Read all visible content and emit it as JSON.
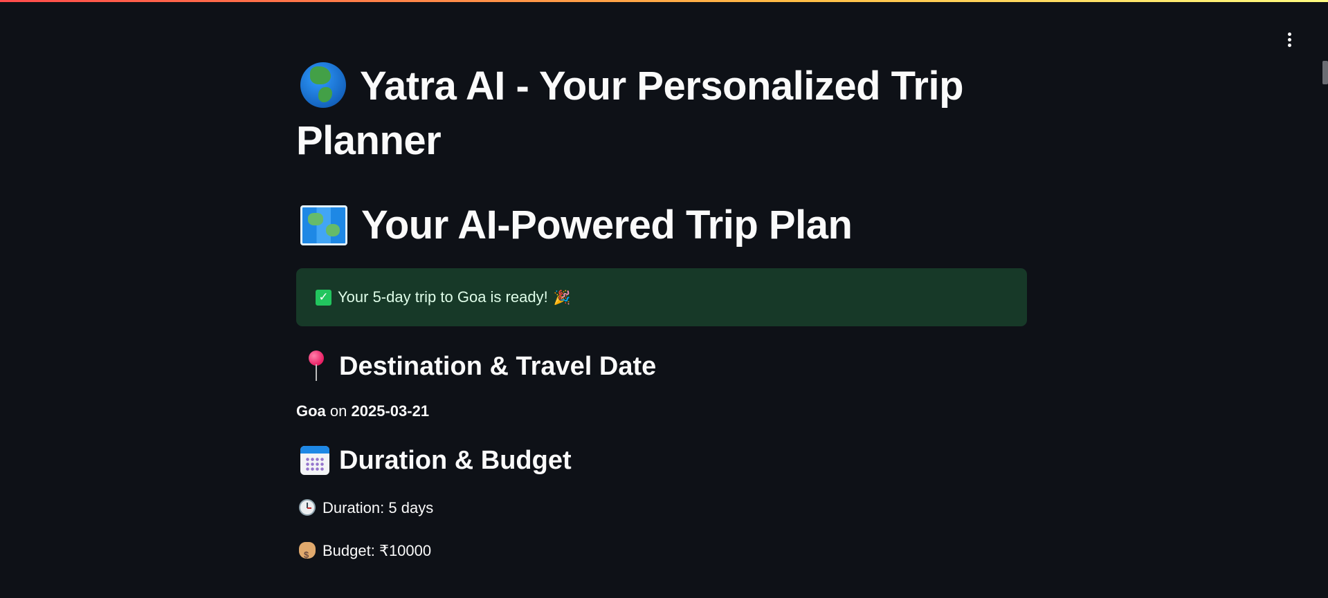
{
  "app": {
    "title": "Yatra AI - Your Personalized Trip Planner",
    "title_icon": "globe-icon"
  },
  "plan": {
    "heading": "Your AI-Powered Trip Plan",
    "heading_icon": "world-map-icon",
    "success_message": "Your 5-day trip to Goa is ready!",
    "success_icon": "check-icon",
    "celebrate_icon": "party-popper-icon"
  },
  "destination": {
    "heading": "Destination & Travel Date",
    "icon": "pushpin-icon",
    "place": "Goa",
    "connector": "on",
    "date": "2025-03-21"
  },
  "duration_budget": {
    "heading": "Duration & Budget",
    "icon": "calendar-icon",
    "duration": "Duration: 5 days",
    "duration_icon": "clock-icon",
    "budget": "Budget: ₹10000",
    "budget_icon": "money-bag-icon"
  },
  "colors": {
    "background": "#0e1117",
    "success_bg": "#173928",
    "success_text": "#dffde9",
    "accent_gradient_start": "#ff4b4b",
    "accent_gradient_end": "#fffd80"
  }
}
